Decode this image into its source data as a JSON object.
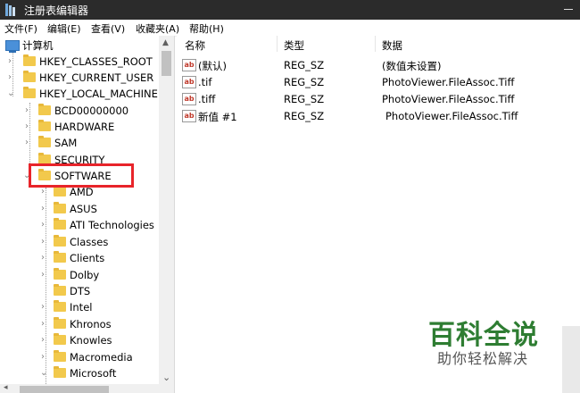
{
  "window": {
    "title": "注册表编辑器"
  },
  "menu": [
    "文件(F)",
    "编辑(E)",
    "查看(V)",
    "收藏夹(A)",
    "帮助(H)"
  ],
  "tree": {
    "root": "计算机",
    "hives": [
      "HKEY_CLASSES_ROOT",
      "HKEY_CURRENT_USER",
      "HKEY_LOCAL_MACHINE"
    ],
    "hklm_children": [
      "BCD00000000",
      "HARDWARE",
      "SAM",
      "SECURITY",
      "SOFTWARE"
    ],
    "software_children": [
      "AMD",
      "ASUS",
      "ATI Technologies",
      "Classes",
      "Clients",
      "Dolby",
      "DTS",
      "Intel",
      "Khronos",
      "Knowles",
      "Macromedia",
      "Microsoft"
    ]
  },
  "list": {
    "headers": {
      "name": "名称",
      "type": "类型",
      "data": "数据"
    },
    "rows": [
      {
        "name": "(默认)",
        "type": "REG_SZ",
        "data": "(数值未设置)"
      },
      {
        "name": ".tif",
        "type": "REG_SZ",
        "data": "PhotoViewer.FileAssoc.Tiff"
      },
      {
        "name": ".tiff",
        "type": "REG_SZ",
        "data": "PhotoViewer.FileAssoc.Tiff"
      },
      {
        "name": "新值 #1",
        "type": "REG_SZ",
        "data": "PhotoViewer.FileAssoc.Tiff"
      }
    ]
  },
  "watermark": {
    "logo": "百科全说",
    "tagline": "助你轻松解决"
  },
  "colors": {
    "highlight": "#e8242a",
    "folder": "#f2c94c",
    "watermark": "#2e7d32"
  }
}
